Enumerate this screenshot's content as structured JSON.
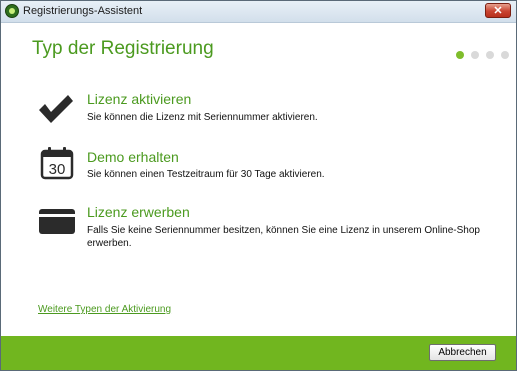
{
  "window": {
    "title": "Registrierungs-Assistent",
    "close_glyph": "✕"
  },
  "header": {
    "title": "Typ der Registrierung"
  },
  "steps": {
    "total": 4,
    "active": 1
  },
  "options": [
    {
      "icon": "checkmark-icon",
      "title": "Lizenz aktivieren",
      "description": "Sie können die Lizenz mit Seriennummer aktivieren."
    },
    {
      "icon": "calendar-icon",
      "calendar_number": "30",
      "title": "Demo erhalten",
      "description": "Sie können einen Testzeitraum für 30 Tage aktivieren."
    },
    {
      "icon": "credit-card-icon",
      "title": "Lizenz erwerben",
      "description": "Falls Sie keine Seriennummer besitzen, können Sie eine Lizenz in unserem Online-Shop erwerben."
    }
  ],
  "link": {
    "label": "Weitere Typen der Aktivierung"
  },
  "footer": {
    "cancel_label": "Abbrechen"
  },
  "colors": {
    "accent": "#4b9a1f",
    "footer": "#71b61f",
    "dot_active": "#7fbd2b",
    "dot_inactive": "#d9d9d9"
  }
}
